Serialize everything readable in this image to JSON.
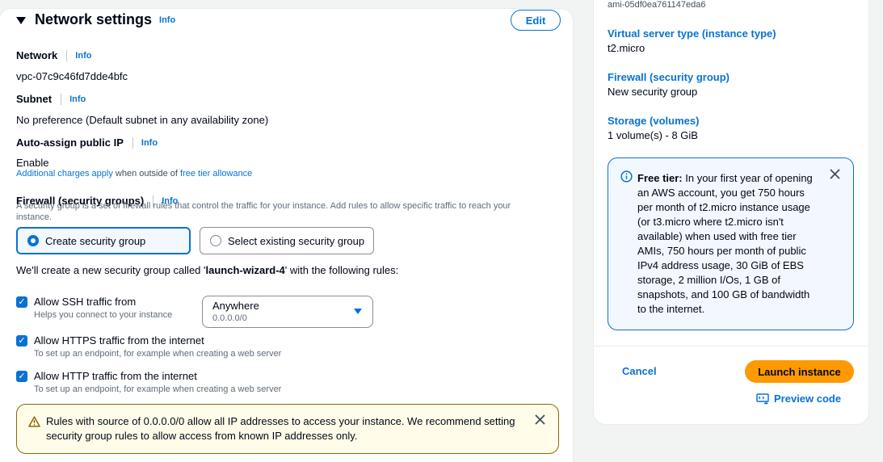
{
  "network_settings": {
    "title": "Network settings",
    "info": "Info",
    "edit_label": "Edit",
    "network": {
      "label": "Network",
      "info": "Info",
      "value": "vpc-07c9c46fd7dde4bfc"
    },
    "subnet": {
      "label": "Subnet",
      "info": "Info",
      "value": "No preference (Default subnet in any availability zone)"
    },
    "public_ip": {
      "label": "Auto-assign public IP",
      "info": "Info",
      "value": "Enable"
    },
    "charges": {
      "link1": "Additional charges apply",
      "middle": " when outside of ",
      "link2": "free tier allowance"
    },
    "firewall": {
      "label": "Firewall (security groups)",
      "info": "Info",
      "description": "A security group is a set of firewall rules that control the traffic for your instance. Add rules to allow specific traffic to reach your instance.",
      "options": [
        "Create security group",
        "Select existing security group"
      ],
      "selected": "Create security group"
    },
    "sg_sentence": {
      "prefix": "We'll create a new security group called '",
      "name": "launch-wizard-4",
      "suffix": "' with the following rules:"
    },
    "rules": [
      {
        "label": "Allow SSH traffic from",
        "desc": "Helps you connect to your instance",
        "checked": true
      },
      {
        "label": "Allow HTTPS traffic from the internet",
        "desc": "To set up an endpoint, for example when creating a web server",
        "checked": true
      },
      {
        "label": "Allow HTTP traffic from the internet",
        "desc": "To set up an endpoint, for example when creating a web server",
        "checked": true
      }
    ],
    "ssh_source": {
      "value": "Anywhere",
      "sub": "0.0.0.0/0"
    },
    "warning": "Rules with source of 0.0.0.0/0 allow all IP addresses to access your instance. We recommend setting security group rules to allow access from known IP addresses only."
  },
  "summary": {
    "ami": "ami-05df0ea761147eda6",
    "instance_type": {
      "label": "Virtual server type (instance type)",
      "value": "t2.micro"
    },
    "firewall": {
      "label": "Firewall (security group)",
      "value": "New security group"
    },
    "storage": {
      "label": "Storage (volumes)",
      "value": "1 volume(s) - 8 GiB"
    },
    "free_tier": {
      "title": "Free tier:",
      "text": " In your first year of opening an AWS account, you get 750 hours per month of t2.micro instance usage (or t3.micro where t2.micro isn't available) when used with free tier AMIs, 750 hours per month of public IPv4 address usage, 30 GiB of EBS storage, 2 million I/Os, 1 GB of snapshots, and 100 GB of bandwidth to the internet."
    },
    "cancel_label": "Cancel",
    "launch_label": "Launch instance",
    "preview_label": "Preview code"
  },
  "colors": {
    "accent": "#0972d3",
    "launch": "#ff9900",
    "warning_border": "#8d6605",
    "warning_bg": "#fffce9",
    "info_bg": "#f2f8fd"
  }
}
